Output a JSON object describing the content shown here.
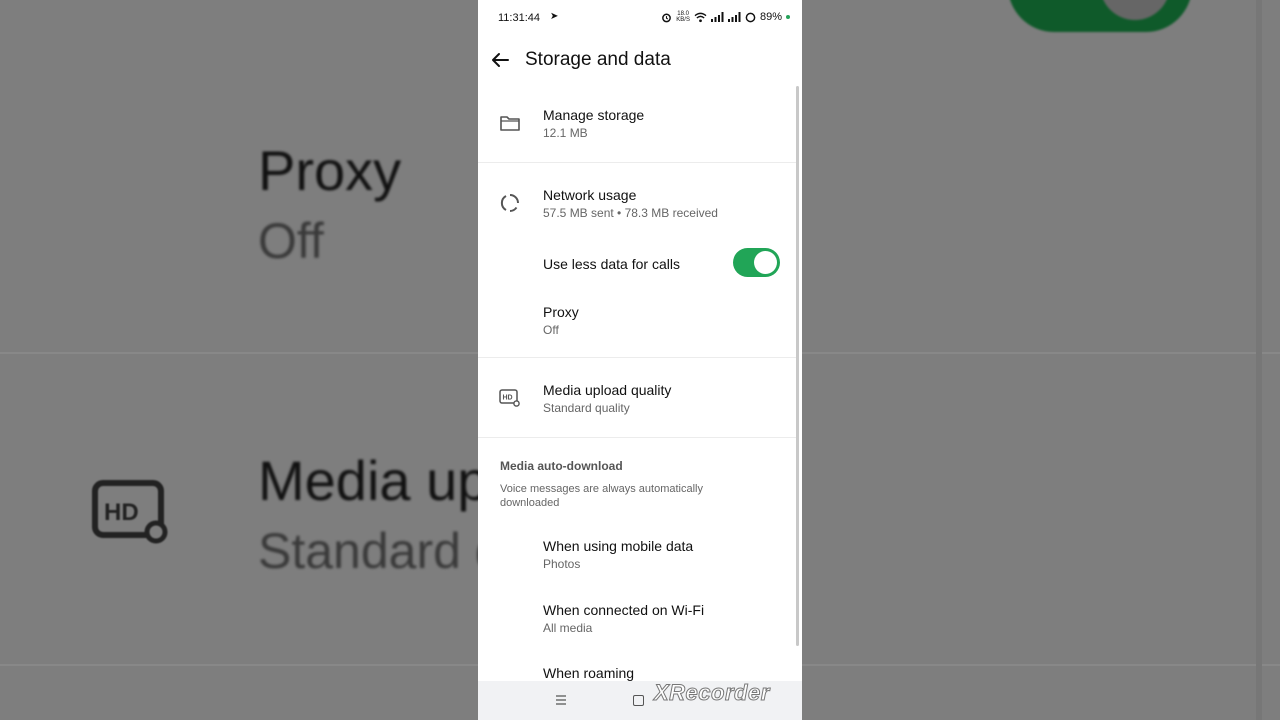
{
  "background": {
    "proxy_label": "Proxy",
    "proxy_value": "Off",
    "media_label": "Media up",
    "media_value": "Standard q"
  },
  "status_bar": {
    "time": "11:31:44",
    "speed_value": "18.0",
    "speed_unit": "KB/S",
    "battery": "89%"
  },
  "appbar": {
    "title": "Storage and data"
  },
  "items": {
    "manage_storage": {
      "label": "Manage storage",
      "sub": "12.1 MB"
    },
    "network_usage": {
      "label": "Network usage",
      "sub": "57.5 MB sent • 78.3 MB received"
    },
    "less_data_calls": {
      "label": "Use less data for calls",
      "enabled": true
    },
    "proxy": {
      "label": "Proxy",
      "sub": "Off"
    },
    "media_upload_quality": {
      "label": "Media upload quality",
      "sub": "Standard quality"
    }
  },
  "auto_download": {
    "title": "Media auto-download",
    "note": "Voice messages are always automatically downloaded",
    "mobile": {
      "label": "When using mobile data",
      "sub": "Photos"
    },
    "wifi": {
      "label": "When connected on Wi-Fi",
      "sub": "All media"
    },
    "roaming": {
      "label": "When roaming"
    }
  },
  "watermark": "XRecorder",
  "colors": {
    "toggle_on": "#21a557",
    "text_primary": "#111111",
    "text_secondary": "#666666",
    "background_dim": "#7e7e7e"
  },
  "icons": [
    "back-arrow-icon",
    "folder-icon",
    "network-usage-icon",
    "hd-settings-icon",
    "menu-icon",
    "home-icon"
  ]
}
